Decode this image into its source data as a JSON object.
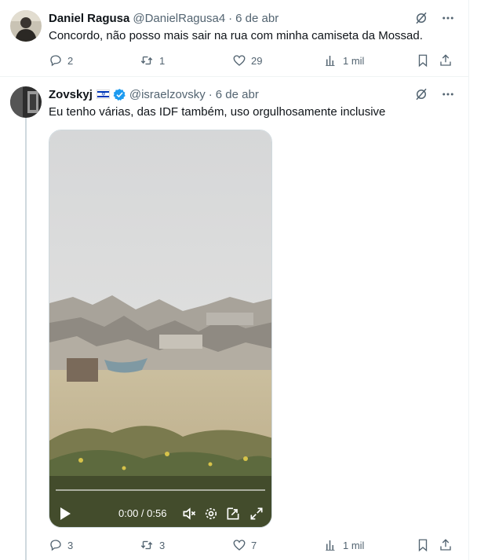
{
  "colors": {
    "text": "#0f1419",
    "muted": "#536471",
    "link": "#1d9bf0",
    "verified": "#1d9bf0",
    "border": "#eff3f4"
  },
  "tweets": [
    {
      "name": "Daniel Ragusa",
      "handle": "@DanielRagusa4",
      "dot": "·",
      "date": "6 de abr",
      "text": "Concordo, não posso mais sair na rua com minha camiseta da Mossad.",
      "replies": "2",
      "reposts": "1",
      "likes": "29",
      "views": "1 mil",
      "icons": [
        "grok-icon",
        "more-icon",
        "reply-icon",
        "repost-icon",
        "like-icon",
        "views-icon",
        "bookmark-icon",
        "share-icon"
      ]
    },
    {
      "name": "Zovskyj",
      "handle": "@israelzovsky",
      "dot": "·",
      "date": "6 de abr",
      "text": "Eu tenho várias, das IDF também, uso orgulhosamente inclusive",
      "replies": "3",
      "reposts": "3",
      "likes": "7",
      "views": "1 mil",
      "flag_icon": "israel-flag-icon",
      "verified_icon": "verified-badge-icon",
      "video": {
        "time": "0:00 / 0:56",
        "progress": 0,
        "icons": [
          "play-icon",
          "mute-icon",
          "settings-icon",
          "pip-icon",
          "fullscreen-icon"
        ]
      }
    }
  ]
}
